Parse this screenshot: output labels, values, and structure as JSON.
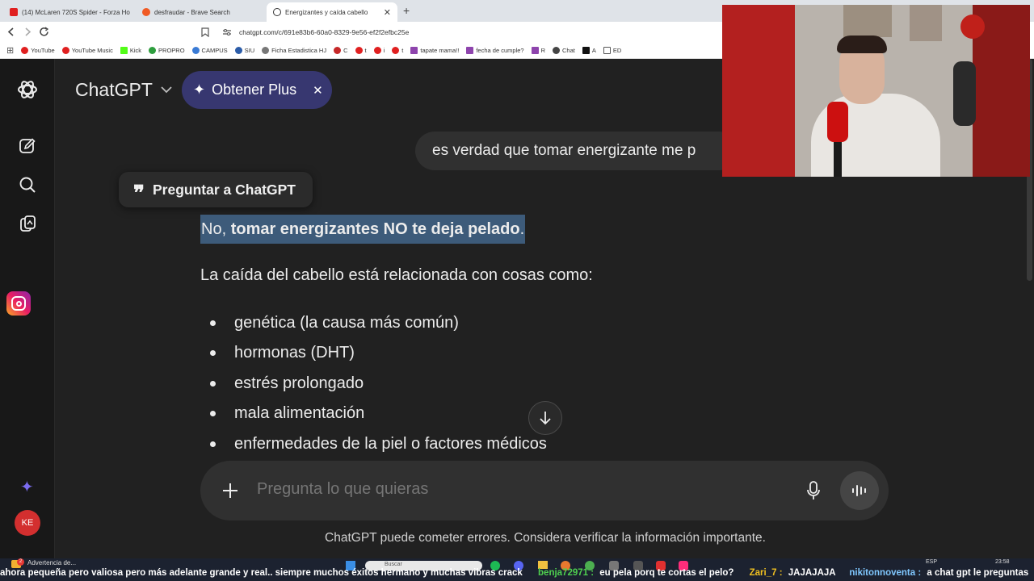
{
  "browser": {
    "tabs": [
      {
        "title": "(14) McLaren 720S Spider - Forza Ho",
        "icon": "youtube-icon",
        "color": "#e02020"
      },
      {
        "title": "desfraudar - Brave Search",
        "icon": "brave-icon",
        "color": "#f05a24"
      },
      {
        "title": "Energizantes y caída cabello",
        "icon": "chatgpt-icon",
        "color": "#333333"
      }
    ],
    "url": "chatgpt.com/c/691e83b6-60a0-8329-9e56-ef2f2efbc25e",
    "bookmarks": [
      {
        "label": "YouTube",
        "color": "#e02020"
      },
      {
        "label": "YouTube Music",
        "color": "#e02020"
      },
      {
        "label": "Kick",
        "color": "#53fc18"
      },
      {
        "label": "PROPRO",
        "color": "#2e9e3e"
      },
      {
        "label": "CAMPUS",
        "color": "#3a7bd5"
      },
      {
        "label": "SIU",
        "color": "#2b5ca8"
      },
      {
        "label": "Ficha Estadistica HJ",
        "color": "#777777"
      },
      {
        "label": "C",
        "color": "#c62828"
      },
      {
        "label": "t",
        "color": "#e02020"
      },
      {
        "label": "i",
        "color": "#e02020"
      },
      {
        "label": "t",
        "color": "#e02020"
      },
      {
        "label": "tapate mama!!",
        "color": "#8e44ad"
      },
      {
        "label": "fecha de cumple?",
        "color": "#8e44ad"
      },
      {
        "label": "R",
        "color": "#8e44ad"
      },
      {
        "label": "Chat",
        "color": "#444444"
      },
      {
        "label": "A",
        "color": "#111111"
      },
      {
        "label": "ED",
        "color": "#555555"
      }
    ]
  },
  "app": {
    "title": "ChatGPT",
    "plus_button": "Obtener Plus",
    "user_message": "es verdad que tomar energizante me p",
    "ask_popup": "Preguntar a ChatGPT",
    "answer": {
      "line1_prefix": "No, ",
      "line1_bold": "tomar energizantes NO te deja pelado",
      "line1_suffix": ".",
      "intro": "La caída del cabello está relacionada con cosas como:",
      "bullets": [
        "genética (la causa más común)",
        "hormonas (DHT)",
        "estrés prolongado",
        "mala alimentación",
        "enfermedades de la piel o factores médicos"
      ]
    },
    "composer_placeholder": "Pregunta lo que quieras",
    "disclaimer": "ChatGPT puede cometer errores. Considera verificar la información importante.",
    "avatar_initials": "KE",
    "accent": "#373770"
  },
  "taskbar": {
    "notification": "Advertencia de...",
    "notification_count": "2",
    "search_placeholder": "Buscar",
    "language": "ESP",
    "time": "23:58"
  },
  "ticker": [
    {
      "user": "",
      "text": "ahora pequeña pero valiosa pero más adelante grande y real.. siempre muchos éxitos hermano y muchas vibras crack",
      "color": "#ffffff"
    },
    {
      "user": "benja72971 :",
      "text": "eu pela porq te cortas el pelo?",
      "color": "#4fd04f"
    },
    {
      "user": "Zari_7 :",
      "text": "JAJAJAJA",
      "color": "#f0c020"
    },
    {
      "user": "nikitonnoventa :",
      "text": "a chat gpt le preguntas",
      "color": "#80c8ff"
    }
  ]
}
